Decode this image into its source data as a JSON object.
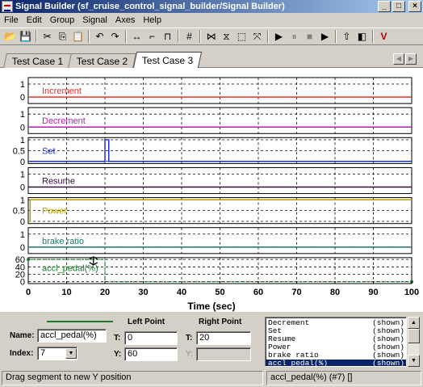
{
  "window": {
    "title": "Signal Builder (sf_cruise_control_signal_builder/Signal Builder)",
    "min": "_",
    "max": "□",
    "close": "×"
  },
  "menu": [
    "File",
    "Edit",
    "Group",
    "Signal",
    "Axes",
    "Help"
  ],
  "toolbar": [
    {
      "name": "open-icon",
      "glyph": "📂"
    },
    {
      "name": "save-icon",
      "glyph": "💾"
    },
    {
      "sep": true
    },
    {
      "name": "cut-icon",
      "glyph": "✂"
    },
    {
      "name": "copy-icon",
      "glyph": "⎘"
    },
    {
      "name": "paste-icon",
      "glyph": "📋"
    },
    {
      "sep": true
    },
    {
      "name": "undo-icon",
      "glyph": "↶"
    },
    {
      "name": "redo-icon",
      "glyph": "↷"
    },
    {
      "sep": true
    },
    {
      "name": "hline-icon",
      "glyph": "↔"
    },
    {
      "name": "step-up-icon",
      "glyph": "⌐"
    },
    {
      "name": "pulse-icon",
      "glyph": "⊓"
    },
    {
      "sep": true
    },
    {
      "name": "grid-icon",
      "glyph": "#"
    },
    {
      "sep": true
    },
    {
      "name": "zoom-x-icon",
      "glyph": "⋈"
    },
    {
      "name": "zoom-y-icon",
      "glyph": "⧖"
    },
    {
      "name": "zoom-box-icon",
      "glyph": "⬚"
    },
    {
      "name": "fit-icon",
      "glyph": "⤧"
    },
    {
      "sep": true
    },
    {
      "name": "play-icon",
      "glyph": "▶"
    },
    {
      "name": "pause-icon",
      "glyph": "⏸"
    },
    {
      "name": "stop-icon",
      "glyph": "■"
    },
    {
      "name": "run-all-icon",
      "glyph": "▶"
    },
    {
      "sep": true
    },
    {
      "name": "goto-model-icon",
      "glyph": "⇧"
    },
    {
      "name": "model-icon",
      "glyph": "◧"
    },
    {
      "sep": true
    },
    {
      "name": "verify-icon",
      "glyph": "V"
    }
  ],
  "tabs": [
    {
      "label": "Test Case 1",
      "active": false
    },
    {
      "label": "Test Case 2",
      "active": false
    },
    {
      "label": "Test Case 3",
      "active": true
    }
  ],
  "tab_arrows": [
    "◀",
    "▶"
  ],
  "chart_data": {
    "type": "line",
    "xlabel": "Time (sec)",
    "xlim": [
      0,
      100
    ],
    "xticks": [
      0,
      10,
      20,
      30,
      40,
      50,
      60,
      70,
      80,
      90,
      100
    ],
    "grid": true,
    "signals": [
      {
        "name": "Increment",
        "color": "#e8302a",
        "ylim": [
          -0.5,
          1.5
        ],
        "yticks": [
          0,
          1
        ],
        "yticklabels": [
          "0",
          "1"
        ],
        "x": [
          0,
          100
        ],
        "y": [
          0,
          0
        ]
      },
      {
        "name": "Decrement",
        "color": "#b020b0",
        "ylim": [
          -0.5,
          1.5
        ],
        "yticks": [
          0,
          1
        ],
        "yticklabels": [
          "0",
          "1"
        ],
        "x": [
          0,
          100
        ],
        "y": [
          0,
          0
        ]
      },
      {
        "name": "Set",
        "color": "#1a2fd8",
        "ylim": [
          -0.1,
          1.1
        ],
        "yticks": [
          0,
          0.5,
          1
        ],
        "yticklabels": [
          "0",
          "0.5",
          "1"
        ],
        "x": [
          0,
          20,
          20,
          21,
          21,
          100
        ],
        "y": [
          0,
          0,
          1,
          1,
          0,
          0
        ]
      },
      {
        "name": "Resume",
        "color": "#3a0a40",
        "ylim": [
          -0.5,
          1.5
        ],
        "yticks": [
          0,
          1
        ],
        "yticklabels": [
          "0",
          "1"
        ],
        "x": [
          0,
          100
        ],
        "y": [
          0,
          0
        ]
      },
      {
        "name": "Power",
        "color": "#b8a000",
        "ylim": [
          -0.1,
          1.1
        ],
        "yticks": [
          0,
          0.5,
          1
        ],
        "yticklabels": [
          "0",
          "0.5",
          "1"
        ],
        "x": [
          0,
          0.5,
          0.5,
          100
        ],
        "y": [
          0,
          0,
          1,
          1
        ]
      },
      {
        "name": "brake ratio",
        "color": "#1c7a6a",
        "ylim": [
          -0.5,
          1.5
        ],
        "yticks": [
          0,
          1
        ],
        "yticklabels": [
          "0",
          "1"
        ],
        "x": [
          0,
          100
        ],
        "y": [
          0,
          0
        ]
      },
      {
        "name": "accl_pedal(%)",
        "color": "#1c7a2d",
        "ylim": [
          -5,
          65
        ],
        "yticks": [
          0,
          20,
          40,
          60
        ],
        "yticklabels": [
          "0",
          "20",
          "40",
          "60"
        ],
        "x": [
          0,
          20,
          20,
          100
        ],
        "y": [
          60,
          60,
          0,
          0
        ],
        "selected": true
      }
    ]
  },
  "signal_props": {
    "name_label": "Name:",
    "name_value": "accl_pedal(%)",
    "index_label": "Index:",
    "index_value": "7",
    "left_point": "Left Point",
    "right_point": "Right Point",
    "t_label": "T:",
    "y_label": "Y:",
    "left_t": "0",
    "left_y": "60",
    "right_t": "20",
    "right_y": ""
  },
  "signal_list": [
    {
      "name": "Decrement",
      "state": "(shown)"
    },
    {
      "name": "Set",
      "state": "(shown)"
    },
    {
      "name": "Resume",
      "state": "(shown)"
    },
    {
      "name": "Power",
      "state": "(shown)"
    },
    {
      "name": "brake ratio",
      "state": "(shown)"
    },
    {
      "name": "accl pedal(%)",
      "state": "(shown)",
      "selected": true
    }
  ],
  "status": {
    "message": "Drag segment to new Y position",
    "selection": "accl_pedal(%) (#7) []"
  }
}
